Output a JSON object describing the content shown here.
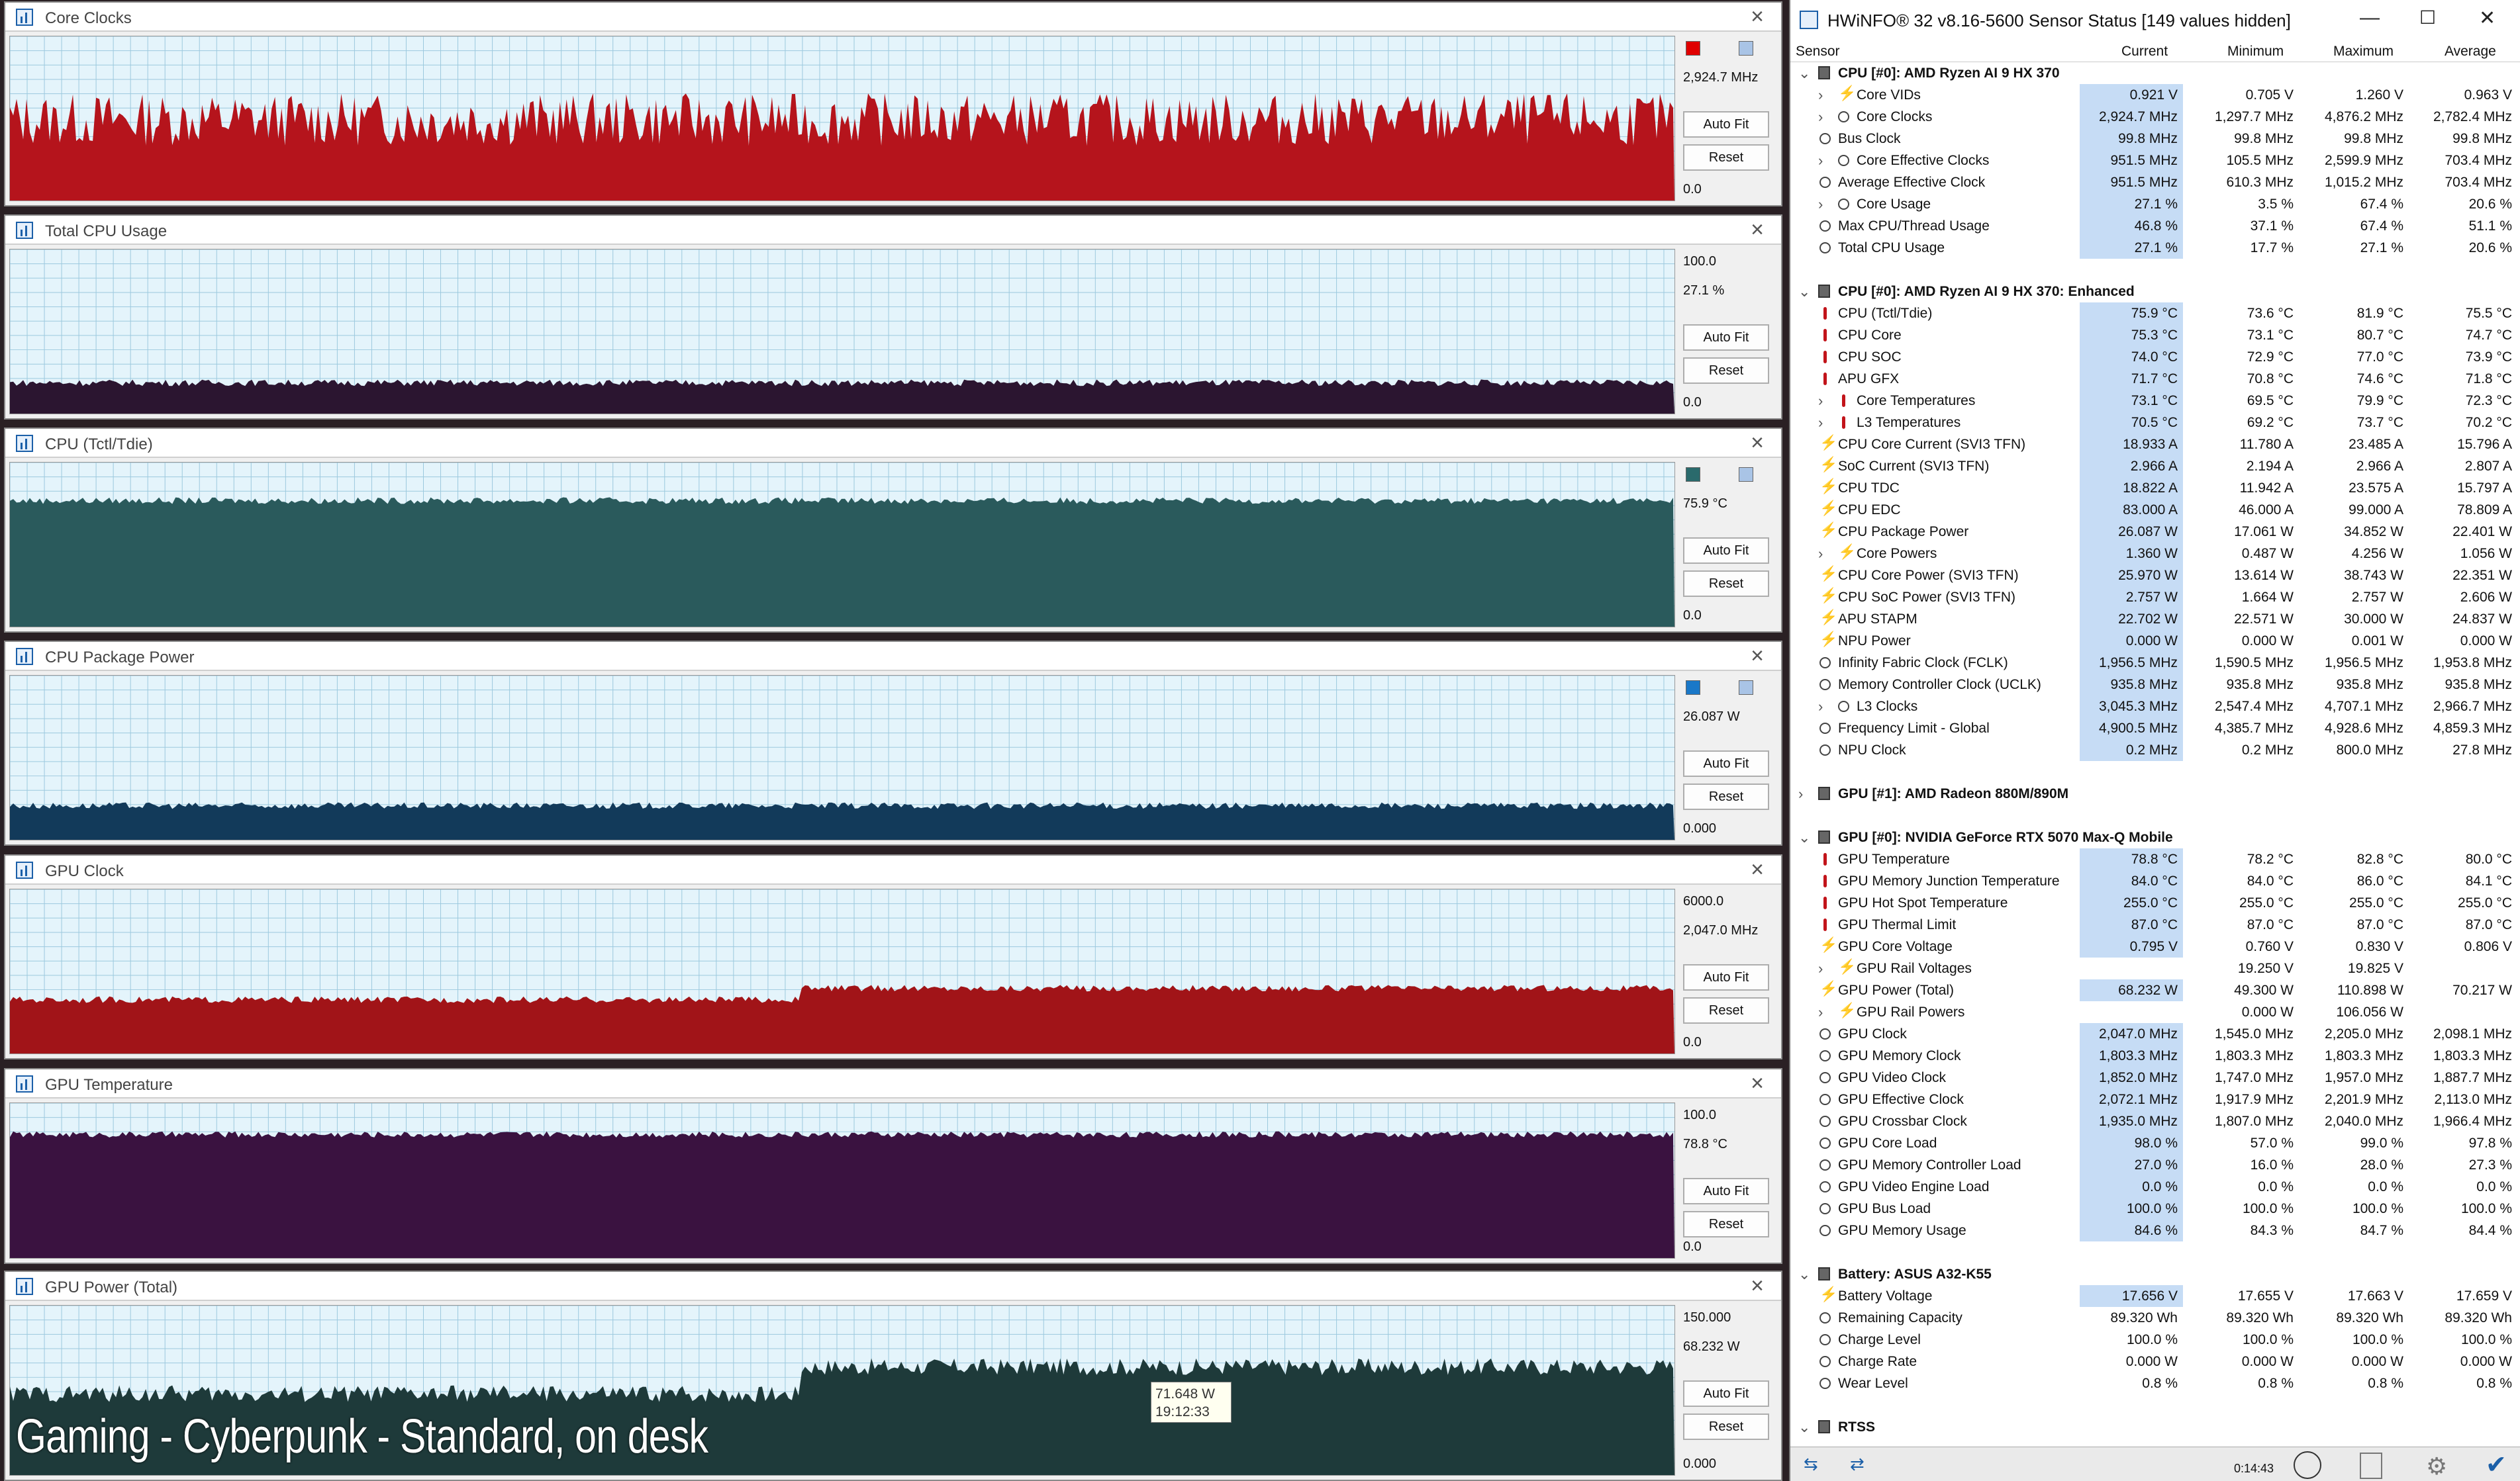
{
  "graphs": [
    {
      "title": "Core Clocks",
      "max": "",
      "current": "2,924.7 MHz",
      "min": "0.0",
      "color": "#b5141c",
      "level": 0.43,
      "auto_fit": "Auto Fit",
      "reset": "Reset",
      "swatch": "#e00000"
    },
    {
      "title": "Total CPU Usage",
      "max": "100.0",
      "current": "27.1 %",
      "min": "0.0",
      "color": "#2b1530",
      "level": 0.18,
      "auto_fit": "Auto Fit",
      "reset": "Reset",
      "swatch": ""
    },
    {
      "title": "CPU (Tctl/Tdie)",
      "max": "",
      "current": "75.9 °C",
      "min": "0.0",
      "color": "#2a5a5c",
      "level": 0.76,
      "auto_fit": "Auto Fit",
      "reset": "Reset",
      "swatch": "#2a6a6c"
    },
    {
      "title": "CPU Package Power",
      "max": "",
      "current": "26.087 W",
      "min": "0.000",
      "color": "#123a5a",
      "level": 0.2,
      "auto_fit": "Auto Fit",
      "reset": "Reset",
      "swatch": "#1a78c8"
    },
    {
      "title": "GPU Clock",
      "max": "6000.0",
      "current": "2,047.0 MHz",
      "min": "0.0",
      "color": "#a11418",
      "level": 0.34,
      "auto_fit": "Auto Fit",
      "reset": "Reset",
      "swatch": ""
    },
    {
      "title": "GPU Temperature",
      "max": "100.0",
      "current": "78.8 °C",
      "min": "0.0",
      "color": "#3a1240",
      "level": 0.79,
      "auto_fit": "Auto Fit",
      "reset": "Reset",
      "swatch": ""
    },
    {
      "title": "GPU Power (Total)",
      "max": "150.000",
      "current": "68.232 W",
      "min": "0.000",
      "color": "#1e3a3a",
      "level": 0.46,
      "auto_fit": "Auto Fit",
      "reset": "Reset",
      "swatch": ""
    }
  ],
  "overlay_caption": "Gaming - Cyberpunk - Standard, on desk",
  "tooltip": {
    "value": "71.648 W",
    "time": "19:12:33"
  },
  "sensor": {
    "title": "HWiNFO® 32 v8.16-5600 Sensor Status [149 values hidden]",
    "columns": [
      "Sensor",
      "Current",
      "Minimum",
      "Maximum",
      "Average"
    ],
    "rows": [
      {
        "type": "group",
        "name": "CPU [#0]: AMD Ryzen AI 9 HX 370"
      },
      {
        "type": "row",
        "icon": "bolt",
        "exp": true,
        "name": "Core VIDs",
        "cur": "0.921 V",
        "min": "0.705 V",
        "max": "1.260 V",
        "avg": "0.963 V"
      },
      {
        "type": "row",
        "icon": "clock",
        "exp": true,
        "name": "Core Clocks",
        "cur": "2,924.7 MHz",
        "min": "1,297.7 MHz",
        "max": "4,876.2 MHz",
        "avg": "2,782.4 MHz"
      },
      {
        "type": "row",
        "icon": "clock",
        "name": "Bus Clock",
        "cur": "99.8 MHz",
        "min": "99.8 MHz",
        "max": "99.8 MHz",
        "avg": "99.8 MHz"
      },
      {
        "type": "row",
        "icon": "clock",
        "exp": true,
        "name": "Core Effective Clocks",
        "cur": "951.5 MHz",
        "min": "105.5 MHz",
        "max": "2,599.9 MHz",
        "avg": "703.4 MHz"
      },
      {
        "type": "row",
        "icon": "clock",
        "name": "Average Effective Clock",
        "cur": "951.5 MHz",
        "min": "610.3 MHz",
        "max": "1,015.2 MHz",
        "avg": "703.4 MHz"
      },
      {
        "type": "row",
        "icon": "clock",
        "exp": true,
        "name": "Core Usage",
        "cur": "27.1 %",
        "min": "3.5 %",
        "max": "67.4 %",
        "avg": "20.6 %"
      },
      {
        "type": "row",
        "icon": "clock",
        "name": "Max CPU/Thread Usage",
        "cur": "46.8 %",
        "min": "37.1 %",
        "max": "67.4 %",
        "avg": "51.1 %"
      },
      {
        "type": "row",
        "icon": "clock",
        "name": "Total CPU Usage",
        "cur": "27.1 %",
        "min": "17.7 %",
        "max": "27.1 %",
        "avg": "20.6 %"
      },
      {
        "type": "blank"
      },
      {
        "type": "group",
        "name": "CPU [#0]: AMD Ryzen AI 9 HX 370: Enhanced"
      },
      {
        "type": "row",
        "icon": "temp",
        "name": "CPU (Tctl/Tdie)",
        "cur": "75.9 °C",
        "min": "73.6 °C",
        "max": "81.9 °C",
        "avg": "75.5 °C"
      },
      {
        "type": "row",
        "icon": "temp",
        "name": "CPU Core",
        "cur": "75.3 °C",
        "min": "73.1 °C",
        "max": "80.7 °C",
        "avg": "74.7 °C"
      },
      {
        "type": "row",
        "icon": "temp",
        "name": "CPU SOC",
        "cur": "74.0 °C",
        "min": "72.9 °C",
        "max": "77.0 °C",
        "avg": "73.9 °C"
      },
      {
        "type": "row",
        "icon": "temp",
        "name": "APU GFX",
        "cur": "71.7 °C",
        "min": "70.8 °C",
        "max": "74.6 °C",
        "avg": "71.8 °C"
      },
      {
        "type": "row",
        "icon": "temp",
        "exp": true,
        "name": "Core Temperatures",
        "cur": "73.1 °C",
        "min": "69.5 °C",
        "max": "79.9 °C",
        "avg": "72.3 °C"
      },
      {
        "type": "row",
        "icon": "temp",
        "exp": true,
        "name": "L3 Temperatures",
        "cur": "70.5 °C",
        "min": "69.2 °C",
        "max": "73.7 °C",
        "avg": "70.2 °C"
      },
      {
        "type": "row",
        "icon": "bolt",
        "name": "CPU Core Current (SVI3 TFN)",
        "cur": "18.933 A",
        "min": "11.780 A",
        "max": "23.485 A",
        "avg": "15.796 A"
      },
      {
        "type": "row",
        "icon": "bolt",
        "name": "SoC Current (SVI3 TFN)",
        "cur": "2.966 A",
        "min": "2.194 A",
        "max": "2.966 A",
        "avg": "2.807 A"
      },
      {
        "type": "row",
        "icon": "bolt",
        "name": "CPU TDC",
        "cur": "18.822 A",
        "min": "11.942 A",
        "max": "23.575 A",
        "avg": "15.797 A"
      },
      {
        "type": "row",
        "icon": "bolt",
        "name": "CPU EDC",
        "cur": "83.000 A",
        "min": "46.000 A",
        "max": "99.000 A",
        "avg": "78.809 A"
      },
      {
        "type": "row",
        "icon": "bolt",
        "name": "CPU Package Power",
        "cur": "26.087 W",
        "min": "17.061 W",
        "max": "34.852 W",
        "avg": "22.401 W"
      },
      {
        "type": "row",
        "icon": "bolt",
        "exp": true,
        "name": "Core Powers",
        "cur": "1.360 W",
        "min": "0.487 W",
        "max": "4.256 W",
        "avg": "1.056 W"
      },
      {
        "type": "row",
        "icon": "bolt",
        "name": "CPU Core Power (SVI3 TFN)",
        "cur": "25.970 W",
        "min": "13.614 W",
        "max": "38.743 W",
        "avg": "22.351 W"
      },
      {
        "type": "row",
        "icon": "bolt",
        "name": "CPU SoC Power (SVI3 TFN)",
        "cur": "2.757 W",
        "min": "1.664 W",
        "max": "2.757 W",
        "avg": "2.606 W"
      },
      {
        "type": "row",
        "icon": "bolt",
        "name": "APU STAPM",
        "cur": "22.702 W",
        "min": "22.571 W",
        "max": "30.000 W",
        "avg": "24.837 W"
      },
      {
        "type": "row",
        "icon": "bolt",
        "name": "NPU Power",
        "cur": "0.000 W",
        "min": "0.000 W",
        "max": "0.001 W",
        "avg": "0.000 W"
      },
      {
        "type": "row",
        "icon": "clock",
        "name": "Infinity Fabric Clock (FCLK)",
        "cur": "1,956.5 MHz",
        "min": "1,590.5 MHz",
        "max": "1,956.5 MHz",
        "avg": "1,953.8 MHz"
      },
      {
        "type": "row",
        "icon": "clock",
        "name": "Memory Controller Clock (UCLK)",
        "cur": "935.8 MHz",
        "min": "935.8 MHz",
        "max": "935.8 MHz",
        "avg": "935.8 MHz"
      },
      {
        "type": "row",
        "icon": "clock",
        "exp": true,
        "name": "L3 Clocks",
        "cur": "3,045.3 MHz",
        "min": "2,547.4 MHz",
        "max": "4,707.1 MHz",
        "avg": "2,966.7 MHz"
      },
      {
        "type": "row",
        "icon": "clock",
        "name": "Frequency Limit - Global",
        "cur": "4,900.5 MHz",
        "min": "4,385.7 MHz",
        "max": "4,928.6 MHz",
        "avg": "4,859.3 MHz"
      },
      {
        "type": "row",
        "icon": "clock",
        "name": "NPU Clock",
        "cur": "0.2 MHz",
        "min": "0.2 MHz",
        "max": "800.0 MHz",
        "avg": "27.8 MHz"
      },
      {
        "type": "blank"
      },
      {
        "type": "group",
        "collapsed": true,
        "name": "GPU [#1]: AMD Radeon 880M/890M"
      },
      {
        "type": "blank"
      },
      {
        "type": "group",
        "name": "GPU [#0]: NVIDIA  GeForce RTX 5070 Max-Q Mobile"
      },
      {
        "type": "row",
        "icon": "temp",
        "name": "GPU Temperature",
        "cur": "78.8 °C",
        "min": "78.2 °C",
        "max": "82.8 °C",
        "avg": "80.0 °C"
      },
      {
        "type": "row",
        "icon": "temp",
        "name": "GPU Memory Junction Temperature",
        "cur": "84.0 °C",
        "min": "84.0 °C",
        "max": "86.0 °C",
        "avg": "84.1 °C"
      },
      {
        "type": "row",
        "icon": "temp",
        "name": "GPU Hot Spot Temperature",
        "cur": "255.0 °C",
        "min": "255.0 °C",
        "max": "255.0 °C",
        "avg": "255.0 °C"
      },
      {
        "type": "row",
        "icon": "temp",
        "name": "GPU Thermal Limit",
        "cur": "87.0 °C",
        "min": "87.0 °C",
        "max": "87.0 °C",
        "avg": "87.0 °C"
      },
      {
        "type": "row",
        "icon": "bolt",
        "name": "GPU Core Voltage",
        "cur": "0.795 V",
        "min": "0.760 V",
        "max": "0.830 V",
        "avg": "0.806 V"
      },
      {
        "type": "row",
        "icon": "bolt",
        "exp": true,
        "name": "GPU Rail Voltages",
        "cur": "",
        "min": "19.250 V",
        "max": "19.825 V",
        "avg": ""
      },
      {
        "type": "row",
        "icon": "bolt",
        "name": "GPU Power (Total)",
        "cur": "68.232 W",
        "min": "49.300 W",
        "max": "110.898 W",
        "avg": "70.217 W"
      },
      {
        "type": "row",
        "icon": "bolt",
        "exp": true,
        "name": "GPU Rail Powers",
        "cur": "",
        "min": "0.000 W",
        "max": "106.056 W",
        "avg": ""
      },
      {
        "type": "row",
        "icon": "clock",
        "name": "GPU Clock",
        "cur": "2,047.0 MHz",
        "min": "1,545.0 MHz",
        "max": "2,205.0 MHz",
        "avg": "2,098.1 MHz"
      },
      {
        "type": "row",
        "icon": "clock",
        "name": "GPU Memory Clock",
        "cur": "1,803.3 MHz",
        "min": "1,803.3 MHz",
        "max": "1,803.3 MHz",
        "avg": "1,803.3 MHz"
      },
      {
        "type": "row",
        "icon": "clock",
        "name": "GPU Video Clock",
        "cur": "1,852.0 MHz",
        "min": "1,747.0 MHz",
        "max": "1,957.0 MHz",
        "avg": "1,887.7 MHz"
      },
      {
        "type": "row",
        "icon": "clock",
        "name": "GPU Effective Clock",
        "cur": "2,072.1 MHz",
        "min": "1,917.9 MHz",
        "max": "2,201.9 MHz",
        "avg": "2,113.0 MHz"
      },
      {
        "type": "row",
        "icon": "clock",
        "name": "GPU Crossbar Clock",
        "cur": "1,935.0 MHz",
        "min": "1,807.0 MHz",
        "max": "2,040.0 MHz",
        "avg": "1,966.4 MHz"
      },
      {
        "type": "row",
        "icon": "clock",
        "name": "GPU Core Load",
        "cur": "98.0 %",
        "min": "57.0 %",
        "max": "99.0 %",
        "avg": "97.8 %"
      },
      {
        "type": "row",
        "icon": "clock",
        "name": "GPU Memory Controller Load",
        "cur": "27.0 %",
        "min": "16.0 %",
        "max": "28.0 %",
        "avg": "27.3 %"
      },
      {
        "type": "row",
        "icon": "clock",
        "name": "GPU Video Engine Load",
        "cur": "0.0 %",
        "min": "0.0 %",
        "max": "0.0 %",
        "avg": "0.0 %"
      },
      {
        "type": "row",
        "icon": "clock",
        "name": "GPU Bus Load",
        "cur": "100.0 %",
        "min": "100.0 %",
        "max": "100.0 %",
        "avg": "100.0 %"
      },
      {
        "type": "row",
        "icon": "clock",
        "name": "GPU Memory Usage",
        "cur": "84.6 %",
        "min": "84.3 %",
        "max": "84.7 %",
        "avg": "84.4 %"
      },
      {
        "type": "blank"
      },
      {
        "type": "group",
        "name": "Battery: ASUS  A32-K55"
      },
      {
        "type": "row",
        "icon": "bolt",
        "name": "Battery Voltage",
        "cur": "17.656 V",
        "min": "17.655 V",
        "max": "17.663 V",
        "avg": "17.659 V"
      },
      {
        "type": "row",
        "icon": "clock",
        "name": "Remaining Capacity",
        "cur": "89.320 Wh",
        "min": "89.320 Wh",
        "max": "89.320 Wh",
        "avg": "89.320 Wh",
        "nohl": true
      },
      {
        "type": "row",
        "icon": "clock",
        "name": "Charge Level",
        "cur": "100.0 %",
        "min": "100.0 %",
        "max": "100.0 %",
        "avg": "100.0 %",
        "nohl": true
      },
      {
        "type": "row",
        "icon": "clock",
        "name": "Charge Rate",
        "cur": "0.000 W",
        "min": "0.000 W",
        "max": "0.000 W",
        "avg": "0.000 W",
        "nohl": true
      },
      {
        "type": "row",
        "icon": "clock",
        "name": "Wear Level",
        "cur": "0.8 %",
        "min": "0.8 %",
        "max": "0.8 %",
        "avg": "0.8 %",
        "nohl": true
      },
      {
        "type": "blank"
      },
      {
        "type": "group",
        "name": "RTSS"
      }
    ],
    "status_time": "0:14:43"
  },
  "colors": {
    "plot_bg": "#e4f4fb",
    "grid": "#9cc9de",
    "highlight": "#c6dcf5"
  }
}
